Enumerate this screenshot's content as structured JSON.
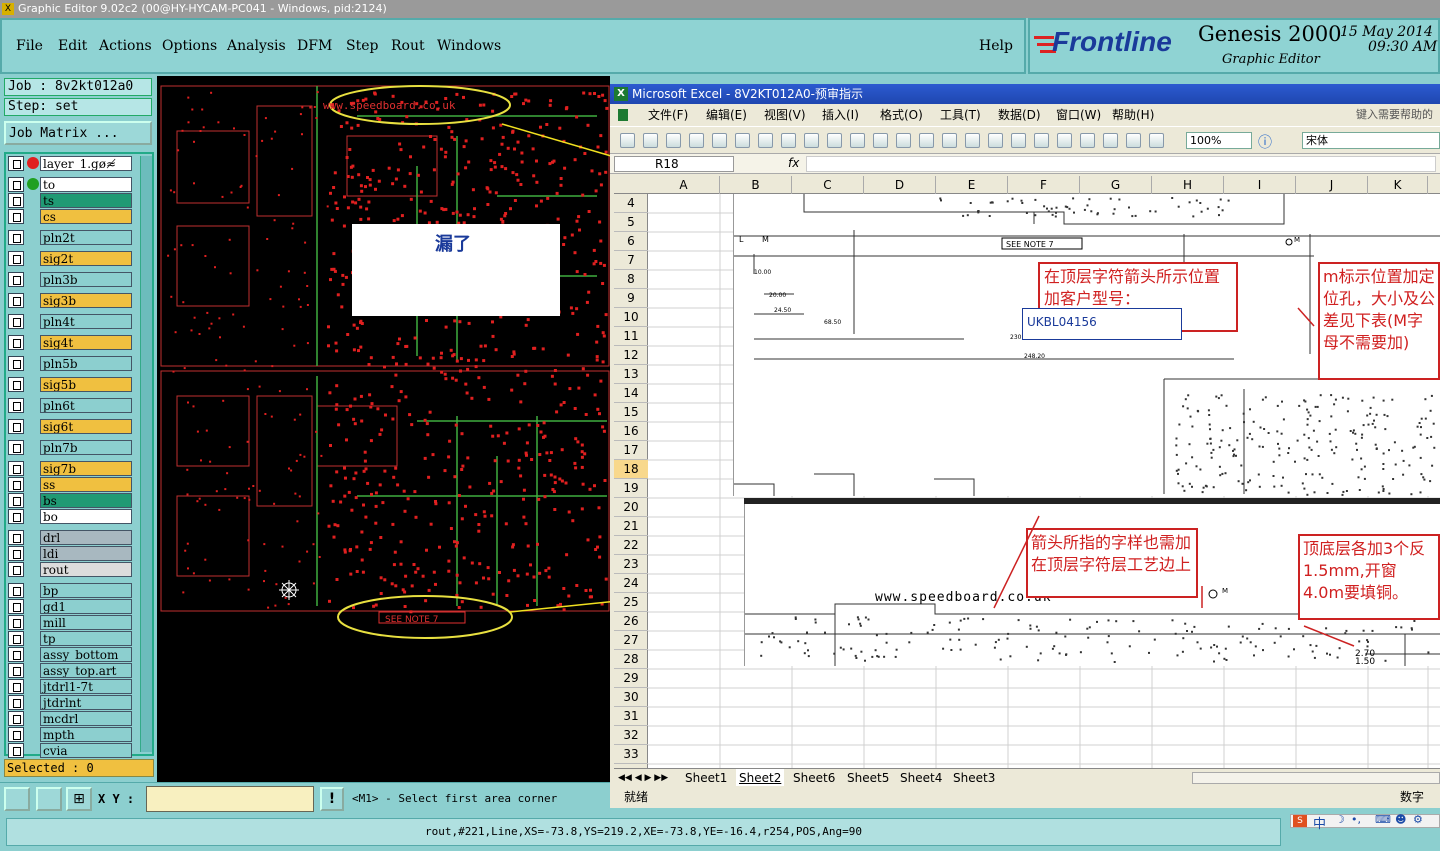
{
  "titlebar": {
    "text": "Graphic Editor 9.02c2 (00@HY-HYCAM-PC041 - Windows, pid:2124)"
  },
  "menu": {
    "items": [
      "File",
      "Edit",
      "Actions",
      "Options",
      "Analysis",
      "DFM",
      "Step",
      "Rout",
      "Windows"
    ],
    "help": "Help"
  },
  "brand": {
    "logo": "Frontline",
    "product": "Genesis 2000",
    "sub": "Graphic Editor",
    "date": "15 May 2014",
    "time": "09:30 AM"
  },
  "job": {
    "job_label": "Job : 8v2kt012a0",
    "step_label": "Step: set",
    "matrix_button": "Job Matrix ..."
  },
  "layers": [
    {
      "name": "layer_1.gø≉",
      "color": "#ffffff"
    },
    {
      "name": "to",
      "color": "#ffffff"
    },
    {
      "name": "ts",
      "color": "#209a74"
    },
    {
      "name": "cs",
      "color": "#f0c040"
    },
    {
      "name": "pln2t",
      "color": "#8ccfcf"
    },
    {
      "name": "sig2t",
      "color": "#f0c040"
    },
    {
      "name": "pln3b",
      "color": "#8ccfcf"
    },
    {
      "name": "sig3b",
      "color": "#f0c040"
    },
    {
      "name": "pln4t",
      "color": "#8ccfcf"
    },
    {
      "name": "sig4t",
      "color": "#f0c040"
    },
    {
      "name": "pln5b",
      "color": "#8ccfcf"
    },
    {
      "name": "sig5b",
      "color": "#f0c040"
    },
    {
      "name": "pln6t",
      "color": "#8ccfcf"
    },
    {
      "name": "sig6t",
      "color": "#f0c040"
    },
    {
      "name": "pln7b",
      "color": "#8ccfcf"
    },
    {
      "name": "sig7b",
      "color": "#f0c040"
    },
    {
      "name": "ss",
      "color": "#f0c040"
    },
    {
      "name": "bs",
      "color": "#209a74"
    },
    {
      "name": "bo",
      "color": "#ffffff"
    },
    {
      "name": "drl",
      "color": "#a8b8c0"
    },
    {
      "name": "ldi",
      "color": "#a8b8c0"
    },
    {
      "name": "rout",
      "color": "#dcdcdc"
    },
    {
      "name": "bp",
      "color": "#8ccfcf"
    },
    {
      "name": "gd1",
      "color": "#8ccfcf"
    },
    {
      "name": "mill",
      "color": "#8ccfcf"
    },
    {
      "name": "tp",
      "color": "#8ccfcf"
    },
    {
      "name": "assy_bottom",
      "color": "#8ccfcf"
    },
    {
      "name": "assy_top.art",
      "color": "#8ccfcf"
    },
    {
      "name": "jtdrl1-7t",
      "color": "#8ccfcf"
    },
    {
      "name": "jtdrlnt",
      "color": "#8ccfcf"
    },
    {
      "name": "mcdrl",
      "color": "#8ccfcf"
    },
    {
      "name": "mpth",
      "color": "#8ccfcf"
    },
    {
      "name": "cvia",
      "color": "#8ccfcf"
    }
  ],
  "selected": "Selected : 0",
  "canvas": {
    "url_text": "www.speedboard.co.uk",
    "see_note": "SEE NOTE 7",
    "missing_label": "漏了"
  },
  "excel": {
    "title": "Microsoft Excel - 8V2KT012A0-预审指示",
    "menus": [
      "文件(F)",
      "编辑(E)",
      "视图(V)",
      "插入(I)",
      "格式(O)",
      "工具(T)",
      "数据(D)",
      "窗口(W)",
      "帮助(H)"
    ],
    "help_hint": "键入需要帮助的",
    "zoom": "100%",
    "font": "宋体",
    "cell_ref": "R18",
    "fx": "fx",
    "columns": [
      "A",
      "B",
      "C",
      "D",
      "E",
      "F",
      "G",
      "H",
      "I",
      "J",
      "K"
    ],
    "rows": [
      "4",
      "5",
      "6",
      "7",
      "8",
      "9",
      "10",
      "11",
      "12",
      "13",
      "14",
      "15",
      "16",
      "17",
      "18",
      "19",
      "20",
      "21",
      "22",
      "23",
      "24",
      "25",
      "26",
      "27",
      "28",
      "29",
      "30",
      "31",
      "32",
      "33"
    ],
    "note1": "在顶层字符箭头所示位置加客户型号：",
    "customer_model": "UKBL04156",
    "note2": "m标示位置加定位孔，大小及公差见下表(M字母不需要加)",
    "note3": "箭头所指的字样也需加在顶层字符层工艺边上",
    "note4": "顶底层各加3个反1.5mm,开窗4.0m要填铜。",
    "drawing_see_note": "SEE NOTE 7",
    "drawing_url": "www.speedboard.co.uk",
    "dims": [
      "10.00",
      "20.00",
      "24.50",
      "68.50",
      "230",
      "248.20",
      "2.70",
      "1.50"
    ],
    "sheets": [
      "Sheet1",
      "Sheet2",
      "Sheet6",
      "Sheet5",
      "Sheet4",
      "Sheet3"
    ],
    "status_left": "就绪",
    "status_right": "数字"
  },
  "bottom": {
    "xy_label": "X Y :",
    "xy_value": "",
    "prompt": "<M1> - Select first area corner",
    "status": "rout,#221,Line,XS=-73.8,YS=219.2,XE=-73.8,YE=-16.4,r254,POS,Ang=90",
    "tray_lang": "中"
  }
}
